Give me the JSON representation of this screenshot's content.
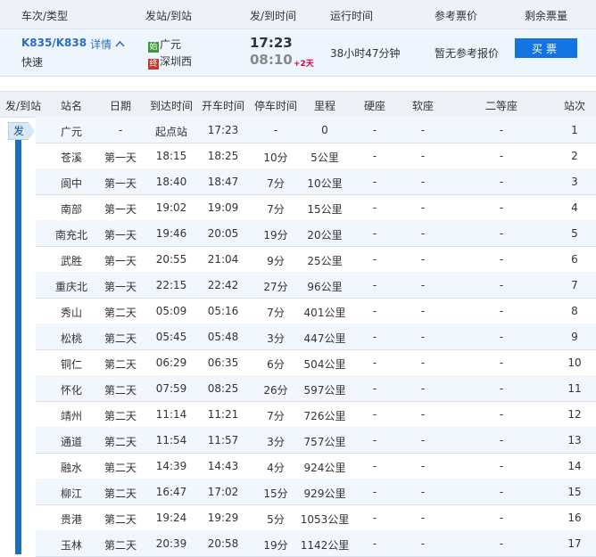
{
  "header": {
    "train_type": "车次/类型",
    "stations": "发站/到站",
    "times": "发/到时间",
    "duration": "运行时间",
    "price": "参考票价",
    "tickets": "剩余票量"
  },
  "train": {
    "code": "K835/K838",
    "detail_label": "详情",
    "type": "快速",
    "from_badge": "始",
    "from_station": "广元",
    "to_badge": "终",
    "to_station": "深圳西",
    "depart_time": "17:23",
    "arrive_time": "08:10",
    "day_offset": "+2天",
    "duration": "38小时47分钟",
    "price_note": "暂无参考报价",
    "buy_label": "买票"
  },
  "table": {
    "headers": {
      "fa_dao": "发/到站",
      "station": "站名",
      "date": "日期",
      "arrive": "到达时间",
      "depart": "开车时间",
      "stop": "停车时间",
      "distance": "里程",
      "hard_seat": "硬座",
      "soft_seat": "软座",
      "second_class": "二等座",
      "seq": "站次"
    },
    "origin_flag": "发",
    "rows": [
      {
        "station": "广元",
        "date": "-",
        "arrive": "起点站",
        "depart": "17:23",
        "stop": "-",
        "distance": "0",
        "hard": "-",
        "soft": "-",
        "second": "-",
        "seq": "1"
      },
      {
        "station": "苍溪",
        "date": "第一天",
        "arrive": "18:15",
        "depart": "18:25",
        "stop": "10分",
        "distance": "5公里",
        "hard": "-",
        "soft": "-",
        "second": "-",
        "seq": "2"
      },
      {
        "station": "阆中",
        "date": "第一天",
        "arrive": "18:40",
        "depart": "18:47",
        "stop": "7分",
        "distance": "10公里",
        "hard": "-",
        "soft": "-",
        "second": "-",
        "seq": "3"
      },
      {
        "station": "南部",
        "date": "第一天",
        "arrive": "19:02",
        "depart": "19:09",
        "stop": "7分",
        "distance": "15公里",
        "hard": "-",
        "soft": "-",
        "second": "-",
        "seq": "4"
      },
      {
        "station": "南充北",
        "date": "第一天",
        "arrive": "19:46",
        "depart": "20:05",
        "stop": "19分",
        "distance": "20公里",
        "hard": "-",
        "soft": "-",
        "second": "-",
        "seq": "5"
      },
      {
        "station": "武胜",
        "date": "第一天",
        "arrive": "20:55",
        "depart": "21:04",
        "stop": "9分",
        "distance": "25公里",
        "hard": "-",
        "soft": "-",
        "second": "-",
        "seq": "6"
      },
      {
        "station": "重庆北",
        "date": "第一天",
        "arrive": "22:15",
        "depart": "22:42",
        "stop": "27分",
        "distance": "96公里",
        "hard": "-",
        "soft": "-",
        "second": "-",
        "seq": "7"
      },
      {
        "station": "秀山",
        "date": "第二天",
        "arrive": "05:09",
        "depart": "05:16",
        "stop": "7分",
        "distance": "401公里",
        "hard": "-",
        "soft": "-",
        "second": "-",
        "seq": "8"
      },
      {
        "station": "松桃",
        "date": "第二天",
        "arrive": "05:45",
        "depart": "05:48",
        "stop": "3分",
        "distance": "447公里",
        "hard": "-",
        "soft": "-",
        "second": "-",
        "seq": "9"
      },
      {
        "station": "铜仁",
        "date": "第二天",
        "arrive": "06:29",
        "depart": "06:35",
        "stop": "6分",
        "distance": "504公里",
        "hard": "-",
        "soft": "-",
        "second": "-",
        "seq": "10"
      },
      {
        "station": "怀化",
        "date": "第二天",
        "arrive": "07:59",
        "depart": "08:25",
        "stop": "26分",
        "distance": "597公里",
        "hard": "-",
        "soft": "-",
        "second": "-",
        "seq": "11"
      },
      {
        "station": "靖州",
        "date": "第二天",
        "arrive": "11:14",
        "depart": "11:21",
        "stop": "7分",
        "distance": "726公里",
        "hard": "-",
        "soft": "-",
        "second": "-",
        "seq": "12"
      },
      {
        "station": "通道",
        "date": "第二天",
        "arrive": "11:54",
        "depart": "11:57",
        "stop": "3分",
        "distance": "757公里",
        "hard": "-",
        "soft": "-",
        "second": "-",
        "seq": "13"
      },
      {
        "station": "融水",
        "date": "第二天",
        "arrive": "14:39",
        "depart": "14:43",
        "stop": "4分",
        "distance": "924公里",
        "hard": "-",
        "soft": "-",
        "second": "-",
        "seq": "14"
      },
      {
        "station": "柳江",
        "date": "第二天",
        "arrive": "16:47",
        "depart": "17:02",
        "stop": "15分",
        "distance": "929公里",
        "hard": "-",
        "soft": "-",
        "second": "-",
        "seq": "15"
      },
      {
        "station": "贵港",
        "date": "第二天",
        "arrive": "19:24",
        "depart": "19:29",
        "stop": "5分",
        "distance": "1053公里",
        "hard": "-",
        "soft": "-",
        "second": "-",
        "seq": "16"
      },
      {
        "station": "玉林",
        "date": "第二天",
        "arrive": "20:39",
        "depart": "20:58",
        "stop": "19分",
        "distance": "1142公里",
        "hard": "-",
        "soft": "-",
        "second": "-",
        "seq": "17"
      }
    ]
  },
  "colors": {
    "link": "#2a6fc2",
    "buy_button": "#1273e1",
    "rail": "#1b6fbf",
    "from_badge": "#3c9a3c",
    "to_badge": "#c0392b",
    "day_offset": "#d8004a"
  }
}
